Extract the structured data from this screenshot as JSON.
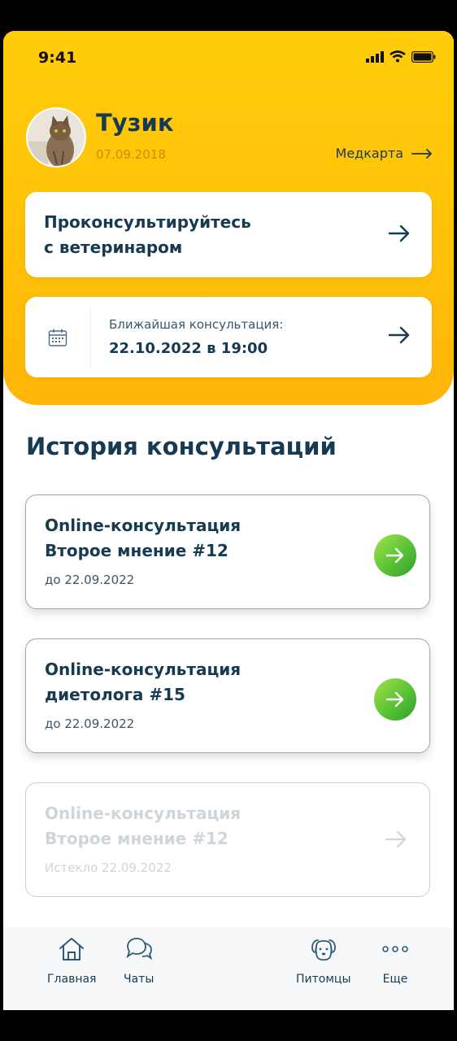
{
  "status_bar": {
    "time": "9:41"
  },
  "pet": {
    "name": "Тузик",
    "birth_date": "07.09.2018",
    "medcard_label": "Медкарта"
  },
  "consult_card": {
    "label": "Проконсультируйтесь\nс ветеринаром"
  },
  "next_consultation": {
    "label": "Ближайшая консультация:",
    "value": "22.10.2022 в 19:00"
  },
  "history": {
    "title": "История консультаций",
    "items": [
      {
        "title": "Online-консультация\nВторое мнение #12",
        "date": "до 22.09.2022",
        "state": "active"
      },
      {
        "title": "Online-консультация\nдиетолога #15",
        "date": "до 22.09.2022",
        "state": "active"
      },
      {
        "title": "Online-консультация\nВторое мнение #12",
        "date": "Истекло 22.09.2022",
        "state": "expired"
      }
    ]
  },
  "tabbar": {
    "home": {
      "label": "Главная",
      "icon": "house-icon"
    },
    "chats": {
      "label": "Чаты",
      "icon": "chat-bubbles-icon"
    },
    "pets": {
      "label": "Питомцы",
      "icon": "dog-icon"
    },
    "more": {
      "label": "Еще",
      "icon": "ellipsis-icon"
    }
  },
  "colors": {
    "accent_yellow": "#ffc107",
    "text_dark": "#163a52",
    "go_green": "#4bbf35"
  }
}
